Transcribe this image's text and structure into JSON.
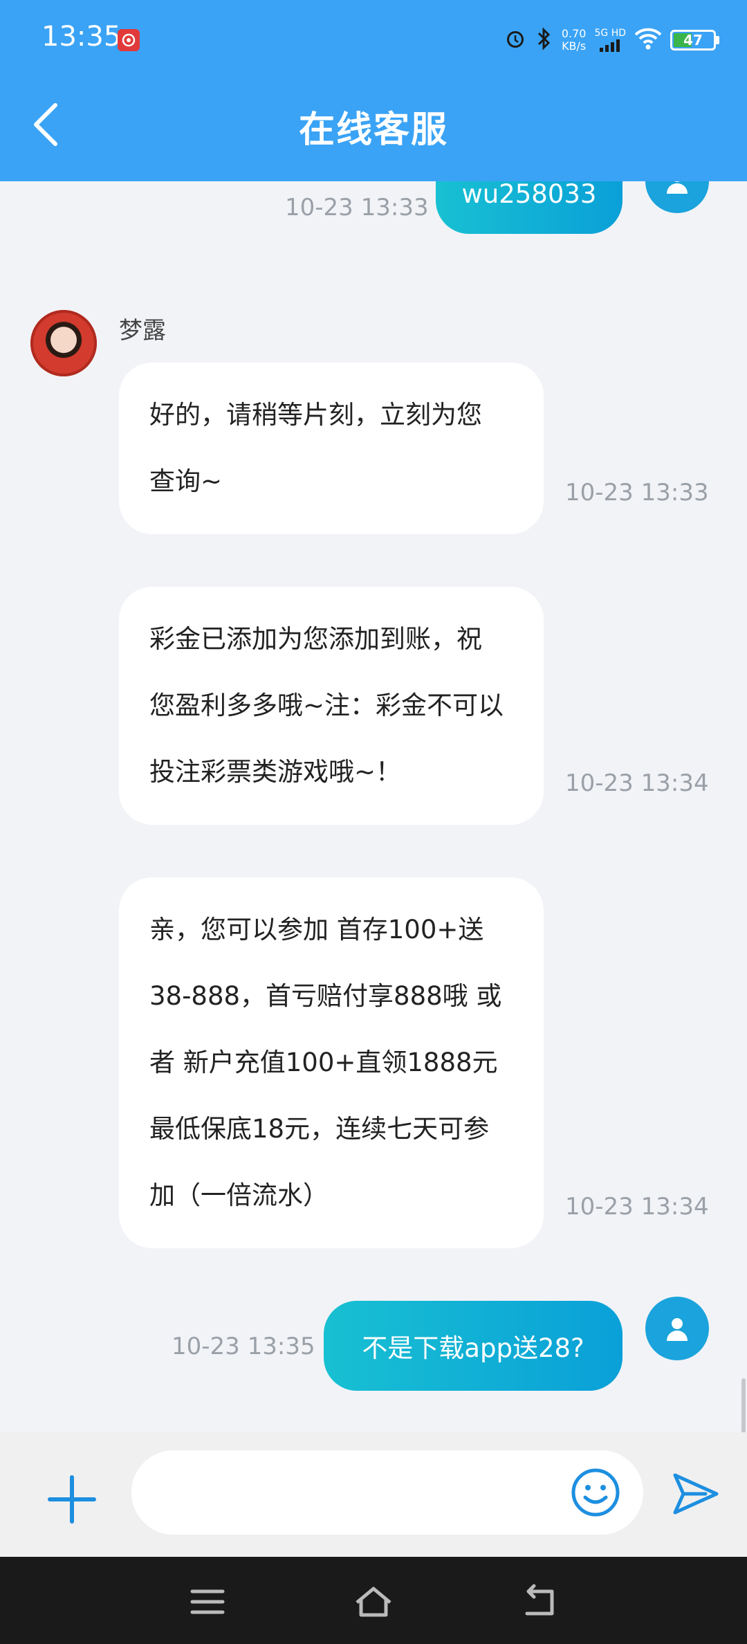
{
  "status_bar": {
    "time": "13:35",
    "speed_value": "0.70",
    "speed_unit": "KB/s",
    "network_label": "5G HD",
    "battery": "47",
    "battery_level": 0.47,
    "icons": [
      "music-app-icon",
      "alarm-icon",
      "bluetooth-icon",
      "signal-icon",
      "wifi-icon",
      "battery-icon"
    ]
  },
  "header": {
    "title": "在线客服",
    "background": "#3aa3f5"
  },
  "messages": [
    {
      "side": "user",
      "text": "wu258033",
      "time": "10-23 13:33"
    },
    {
      "side": "agent",
      "name": "梦露",
      "lines": [
        "好的，请稍等片刻，立刻为您",
        "查询~"
      ],
      "time": "10-23 13:33"
    },
    {
      "side": "agent",
      "lines": [
        "彩金已添加为您添加到账，祝",
        "您盈利多多哦~注：彩金不可以",
        "投注彩票类游戏哦~！"
      ],
      "time": "10-23 13:34"
    },
    {
      "side": "agent",
      "lines": [
        "亲，您可以参加 首存100+送",
        "38-888，首亏赔付享888哦 或",
        "者 新户充值100+直领1888元",
        "最低保底18元，连续七天可参",
        "加（一倍流水）"
      ],
      "time": "10-23 13:34"
    },
    {
      "side": "user",
      "text": "不是下载app送28?",
      "time": "10-23 13:35"
    }
  ],
  "input": {
    "placeholder": "",
    "value": ""
  },
  "colors": {
    "accent": "#3aa3f5",
    "user_bubble": "#0aa0d8",
    "agent_bubble": "#ffffff"
  }
}
